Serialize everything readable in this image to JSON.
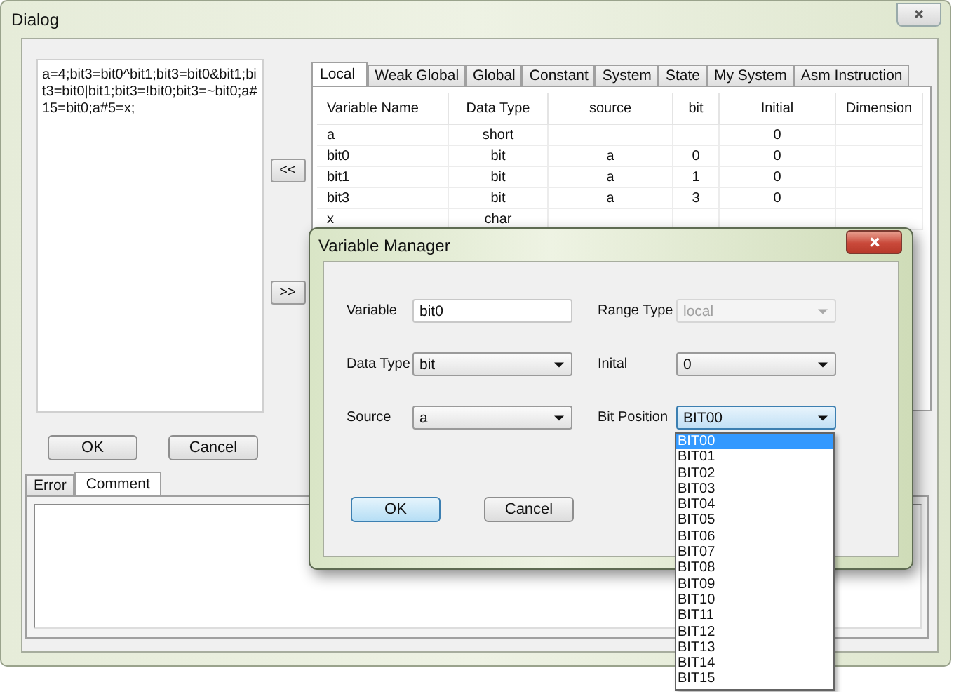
{
  "window": {
    "title": "Dialog"
  },
  "code_text": "a=4;bit3=bit0^bit1;bit3=bit0&bit1;bit3=bit0|bit1;bit3=!bit0;bit3=~bit0;a#15=bit0;a#5=x;",
  "transfer_buttons": [
    "<<",
    ">>"
  ],
  "buttons": [
    "OK",
    "Cancel"
  ],
  "variable_tabs": [
    {
      "label": "Local",
      "selected": true
    },
    {
      "label": "Weak Global",
      "selected": false
    },
    {
      "label": "Global",
      "selected": false
    },
    {
      "label": "Constant",
      "selected": false
    },
    {
      "label": "System",
      "selected": false
    },
    {
      "label": "State",
      "selected": false
    },
    {
      "label": "My System",
      "selected": false
    },
    {
      "label": "Asm Instruction",
      "selected": false
    }
  ],
  "table": {
    "columns": [
      "Variable Name",
      "Data Type",
      "source",
      "bit",
      "Initial",
      "Dimension"
    ],
    "rows": [
      [
        "a",
        "short",
        null,
        null,
        "0",
        null
      ],
      [
        "bit0",
        "bit",
        "a",
        "0",
        "0",
        null
      ],
      [
        "bit1",
        "bit",
        "a",
        "1",
        "0",
        null
      ],
      [
        "bit3",
        "bit",
        "a",
        "3",
        "0",
        null
      ],
      [
        "x",
        "char",
        null,
        null,
        null,
        null
      ]
    ]
  },
  "bottom_tabs": [
    {
      "label": "Error",
      "selected": false
    },
    {
      "label": "Comment",
      "selected": true
    }
  ],
  "variable_manager": {
    "title": "Variable Manager",
    "fields": [
      {
        "label": "Variable",
        "kind": "text",
        "value": "bit0",
        "disabled": false,
        "focused": false
      },
      {
        "label": "Range Type",
        "kind": "select",
        "value": "local",
        "disabled": true,
        "focused": false
      },
      {
        "label": "Data Type",
        "kind": "select",
        "value": "bit",
        "disabled": false,
        "focused": false
      },
      {
        "label": "Inital",
        "kind": "select",
        "value": "0",
        "disabled": false,
        "focused": false
      },
      {
        "label": "Source",
        "kind": "select",
        "value": "a",
        "disabled": false,
        "focused": false
      },
      {
        "label": "Bit Position",
        "kind": "select",
        "value": "BIT00",
        "disabled": false,
        "focused": true,
        "options": [
          {
            "label": "BIT00",
            "selected": true
          },
          {
            "label": "BIT01",
            "selected": false
          },
          {
            "label": "BIT02",
            "selected": false
          },
          {
            "label": "BIT03",
            "selected": false
          },
          {
            "label": "BIT04",
            "selected": false
          },
          {
            "label": "BIT05",
            "selected": false
          },
          {
            "label": "BIT06",
            "selected": false
          },
          {
            "label": "BIT07",
            "selected": false
          },
          {
            "label": "BIT08",
            "selected": false
          },
          {
            "label": "BIT09",
            "selected": false
          },
          {
            "label": "BIT10",
            "selected": false
          },
          {
            "label": "BIT11",
            "selected": false
          },
          {
            "label": "BIT12",
            "selected": false
          },
          {
            "label": "BIT13",
            "selected": false
          },
          {
            "label": "BIT14",
            "selected": false
          },
          {
            "label": "BIT15",
            "selected": false
          }
        ]
      }
    ],
    "buttons": [
      {
        "label": "OK",
        "default": true
      },
      {
        "label": "Cancel",
        "default": false
      }
    ]
  }
}
